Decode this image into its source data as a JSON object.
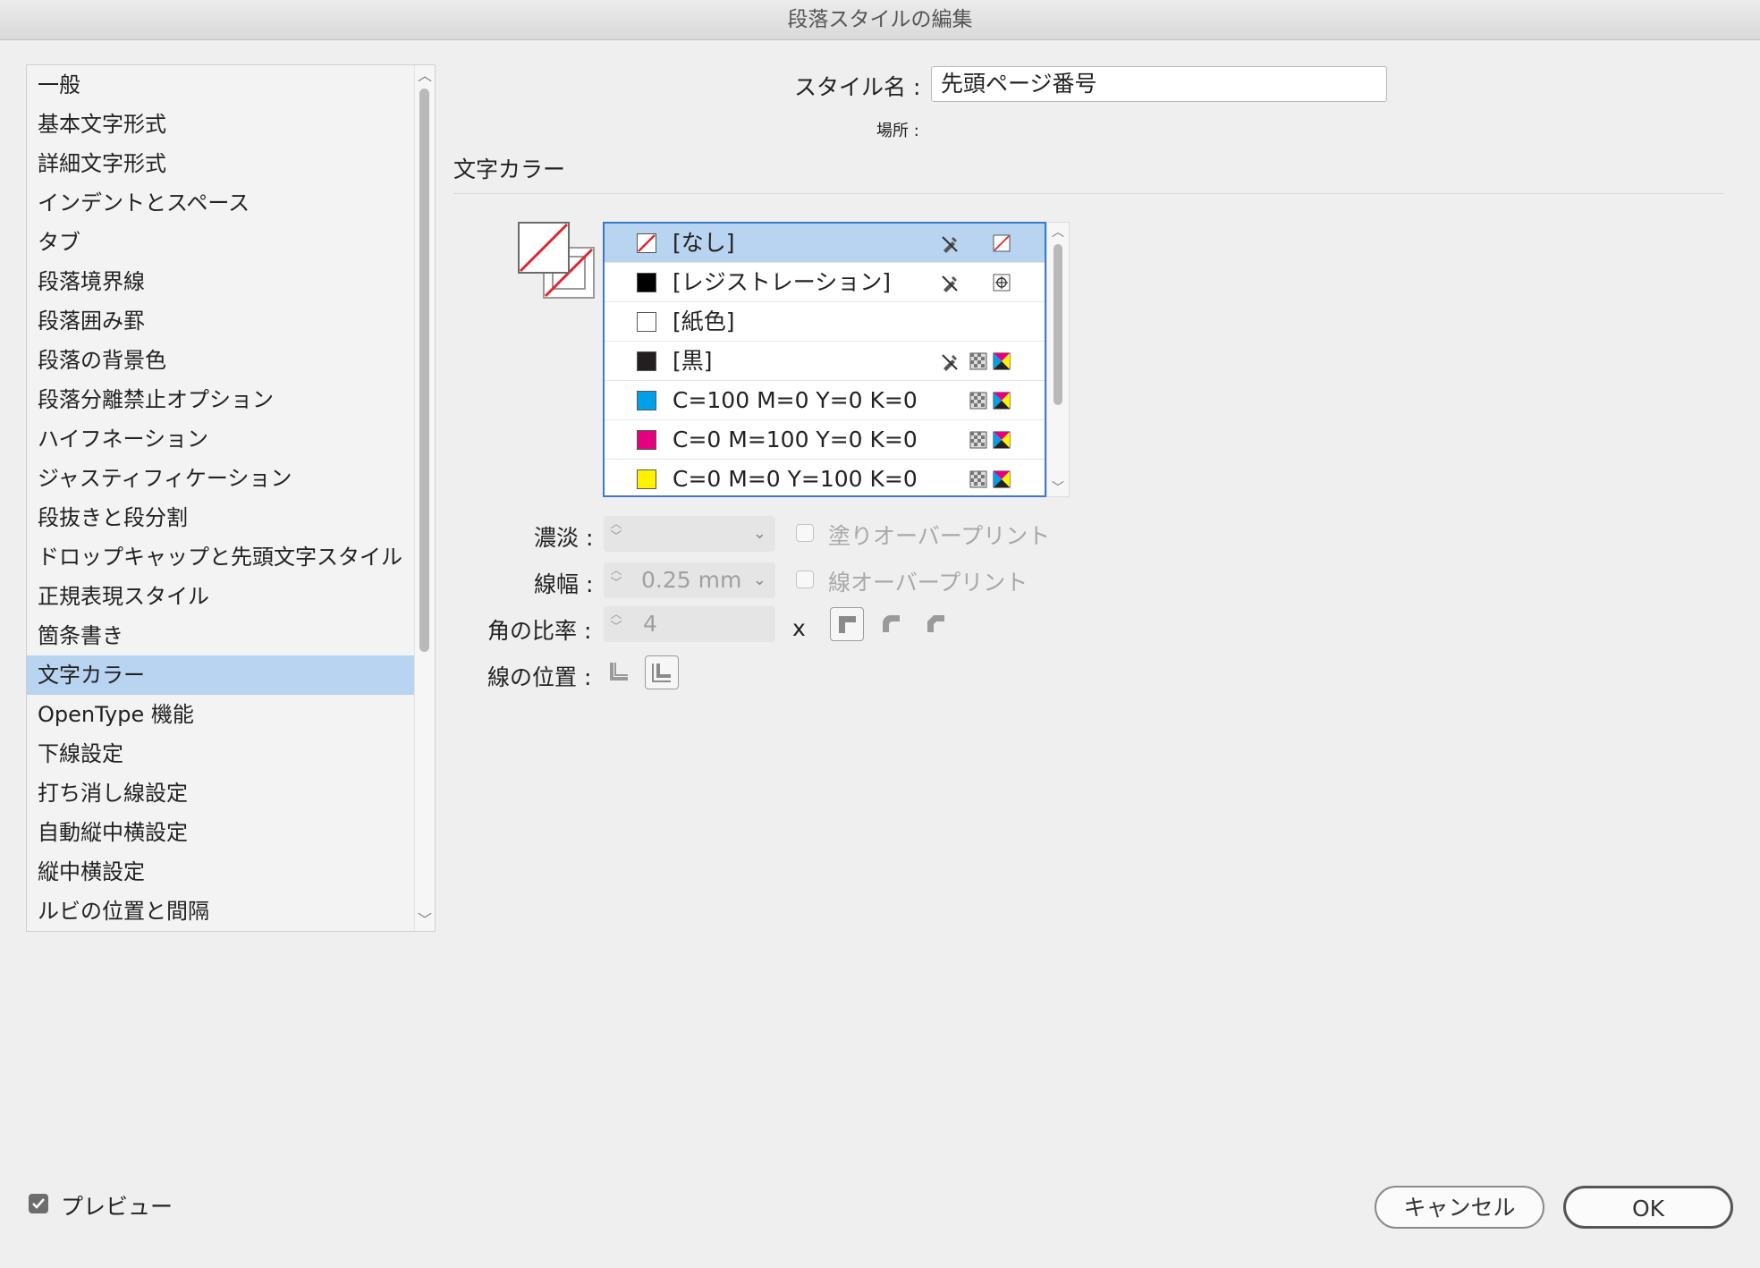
{
  "window": {
    "title": "段落スタイルの編集"
  },
  "sidebar": {
    "items": [
      {
        "label": "一般",
        "selected": false
      },
      {
        "label": "基本文字形式",
        "selected": false
      },
      {
        "label": "詳細文字形式",
        "selected": false
      },
      {
        "label": "インデントとスペース",
        "selected": false
      },
      {
        "label": "タブ",
        "selected": false
      },
      {
        "label": "段落境界線",
        "selected": false
      },
      {
        "label": "段落囲み罫",
        "selected": false
      },
      {
        "label": "段落の背景色",
        "selected": false
      },
      {
        "label": "段落分離禁止オプション",
        "selected": false
      },
      {
        "label": "ハイフネーション",
        "selected": false
      },
      {
        "label": "ジャスティフィケーション",
        "selected": false
      },
      {
        "label": "段抜きと段分割",
        "selected": false
      },
      {
        "label": "ドロップキャップと先頭文字スタイル",
        "selected": false
      },
      {
        "label": "正規表現スタイル",
        "selected": false
      },
      {
        "label": "箇条書き",
        "selected": false
      },
      {
        "label": "文字カラー",
        "selected": true
      },
      {
        "label": "OpenType 機能",
        "selected": false
      },
      {
        "label": "下線設定",
        "selected": false
      },
      {
        "label": "打ち消し線設定",
        "selected": false
      },
      {
        "label": "自動縦中横設定",
        "selected": false
      },
      {
        "label": "縦中横設定",
        "selected": false
      },
      {
        "label": "ルビの位置と間隔",
        "selected": false
      }
    ]
  },
  "style_name": {
    "label": "スタイル名 :",
    "value": "先頭ページ番号"
  },
  "location": {
    "label": "場所 :"
  },
  "section": {
    "title": "文字カラー"
  },
  "swatches": [
    {
      "name": "[なし]",
      "chip": "none",
      "lock": true,
      "mode": "none",
      "selected": true
    },
    {
      "name": "[レジストレーション]",
      "chip": "#000000",
      "lock": true,
      "mode": "registration",
      "selected": false
    },
    {
      "name": "[紙色]",
      "chip": "#ffffff",
      "lock": false,
      "mode": "",
      "selected": false
    },
    {
      "name": "[黒]",
      "chip": "#231f20",
      "lock": true,
      "mode": "cmyk",
      "selected": false
    },
    {
      "name": "C=100 M=0 Y=0 K=0",
      "chip": "#00a0e9",
      "lock": false,
      "mode": "cmyk",
      "selected": false
    },
    {
      "name": "C=0 M=100 Y=0 K=0",
      "chip": "#e4007f",
      "lock": false,
      "mode": "cmyk",
      "selected": false
    },
    {
      "name": "C=0 M=0 Y=100 K=0",
      "chip": "#fff100",
      "lock": false,
      "mode": "cmyk",
      "selected": false
    }
  ],
  "tint": {
    "label": "濃淡 :",
    "value": ""
  },
  "overprint_fill": {
    "label": "塗りオーバープリント",
    "checked": false
  },
  "weight": {
    "label": "線幅 :",
    "value": "0.25 mm"
  },
  "overprint_stroke": {
    "label": "線オーバープリント",
    "checked": false
  },
  "miter": {
    "label": "角の比率 :",
    "value": "4",
    "x_label": "x"
  },
  "stroke_position": {
    "label": "線の位置 :"
  },
  "footer": {
    "preview_label": "プレビュー",
    "preview_checked": true,
    "cancel_label": "キャンセル",
    "ok_label": "OK"
  }
}
